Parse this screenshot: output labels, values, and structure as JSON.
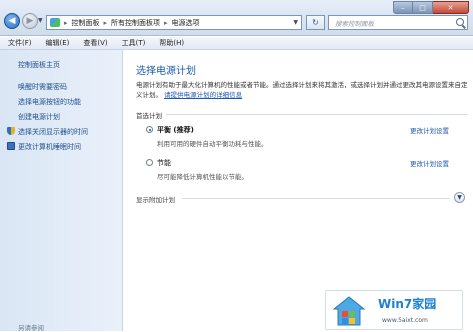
{
  "window": {
    "breadcrumb": [
      "控制面板",
      "所有控制面板项",
      "电源选项"
    ],
    "search_placeholder": "搜索控制面板",
    "controls": {
      "minimize": "–",
      "maximize": "□",
      "close": "✕"
    }
  },
  "menu": [
    "文件(F)",
    "编辑(E)",
    "查看(V)",
    "工具(T)",
    "帮助(H)"
  ],
  "sidebar": {
    "home": "控制面板主页",
    "links": [
      "唤醒时需要密码",
      "选择电源按钮的功能",
      "创建电源计划",
      "选择关闭显示器的时间",
      "更改计算机睡眠时间"
    ],
    "see_also": "另请参阅"
  },
  "main": {
    "title": "选择电源计划",
    "description_1": "电源计划有助于最大化计算机的性能或者节能。通过选择计划来将其激活，或选择计划并通过更改其电源设置来自定义计划。",
    "description_link": "请提供电源计划的详细信息",
    "section_label": "首选计划",
    "plans": [
      {
        "name": "平衡 (推荐)",
        "description": "利用可用的硬件自动平衡功耗与性能。",
        "link": "更改计划设置",
        "selected": true
      },
      {
        "name": "节能",
        "description": "尽可能降低计算机性能以节能。",
        "link": "更改计划设置",
        "selected": false
      }
    ],
    "extra_label": "显示附加计划"
  },
  "watermark": {
    "title": "Win7家园",
    "url": "www.5aixt.com"
  }
}
